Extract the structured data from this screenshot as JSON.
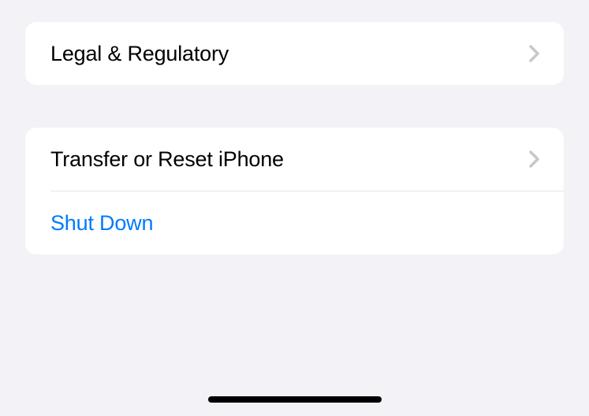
{
  "groups": [
    {
      "items": [
        {
          "label": "Legal & Regulatory",
          "type": "nav"
        }
      ]
    },
    {
      "items": [
        {
          "label": "Transfer or Reset iPhone",
          "type": "nav"
        },
        {
          "label": "Shut Down",
          "type": "action"
        }
      ]
    }
  ],
  "colors": {
    "background": "#f2f2f7",
    "card": "#ffffff",
    "text": "#000000",
    "link": "#007aff",
    "chevron": "#c7c7cc",
    "separator": "#e5e5ea"
  }
}
